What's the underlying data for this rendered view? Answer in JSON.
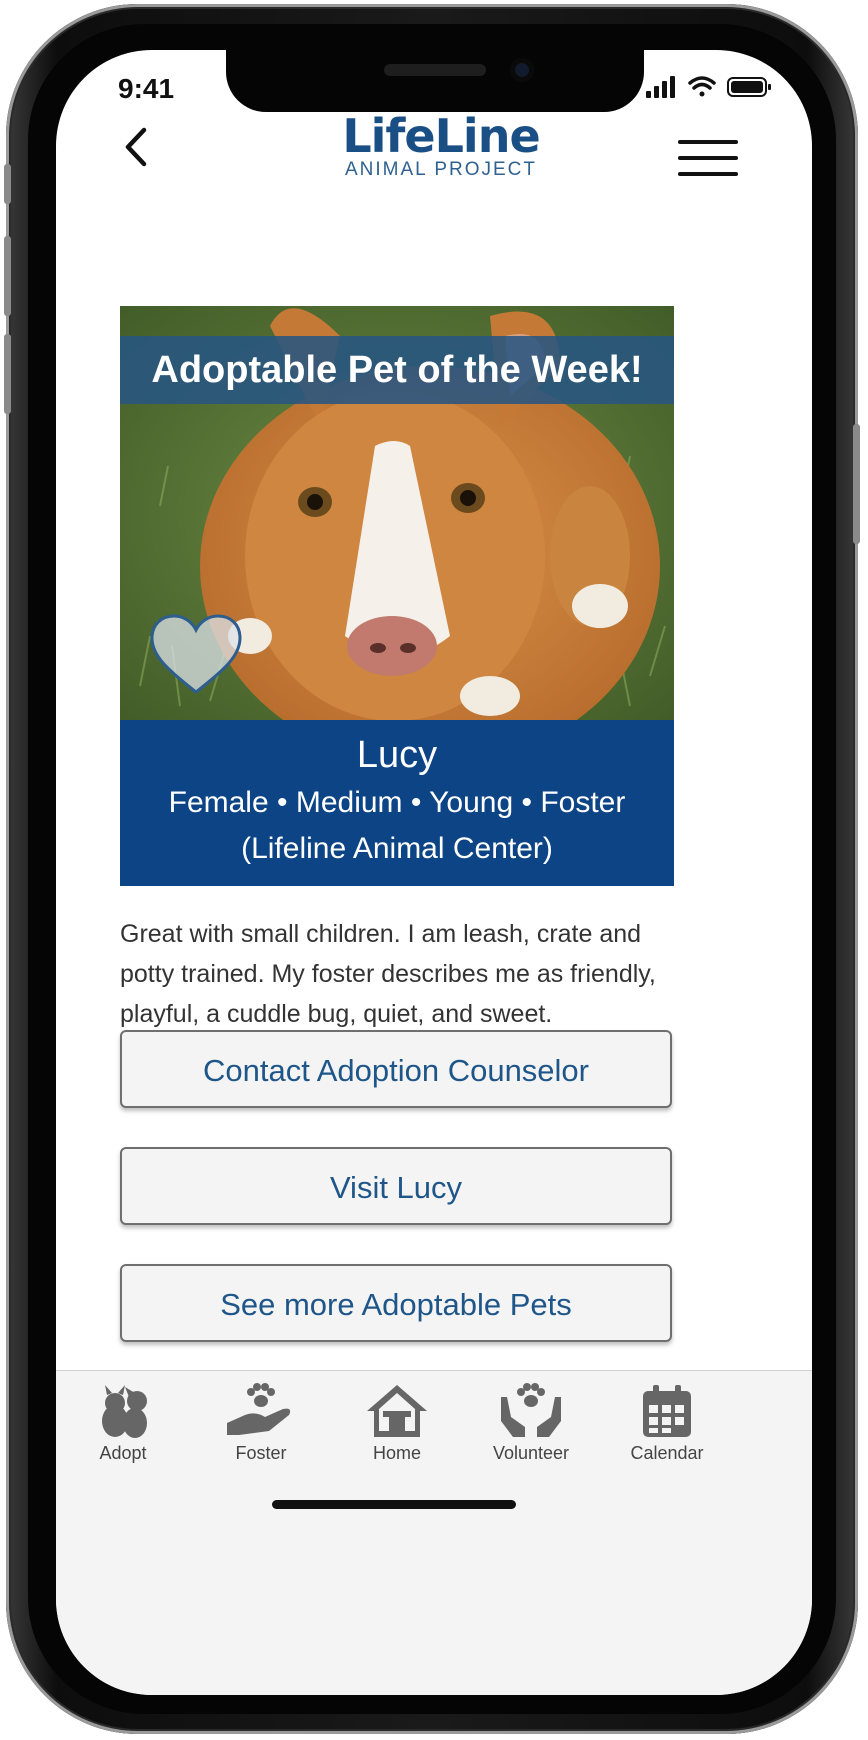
{
  "status": {
    "time": "9:41"
  },
  "header": {
    "logo_main": "LifeLine",
    "logo_sub": "ANIMAL PROJECT"
  },
  "feature": {
    "banner": "Adoptable Pet of the Week!",
    "name": "Lucy",
    "meta": "Female • Medium • Young • Foster",
    "location": "(Lifeline Animal Center)",
    "description": "Great with small children. I am leash, crate and potty trained. My foster describes me as friendly, playful, a cuddle bug, quiet, and sweet."
  },
  "actions": {
    "contact": "Contact Adoption Counselor",
    "visit": "Visit Lucy",
    "more": "See more Adoptable Pets"
  },
  "tabs": [
    {
      "label": "Adopt",
      "icon": "pets-icon"
    },
    {
      "label": "Foster",
      "icon": "hand-paw-icon"
    },
    {
      "label": "Home",
      "icon": "house-icon"
    },
    {
      "label": "Volunteer",
      "icon": "hands-paw-icon"
    },
    {
      "label": "Calendar",
      "icon": "calendar-icon"
    }
  ],
  "colors": {
    "brand_blue": "#0c4485",
    "accent_text": "#1f5689"
  }
}
